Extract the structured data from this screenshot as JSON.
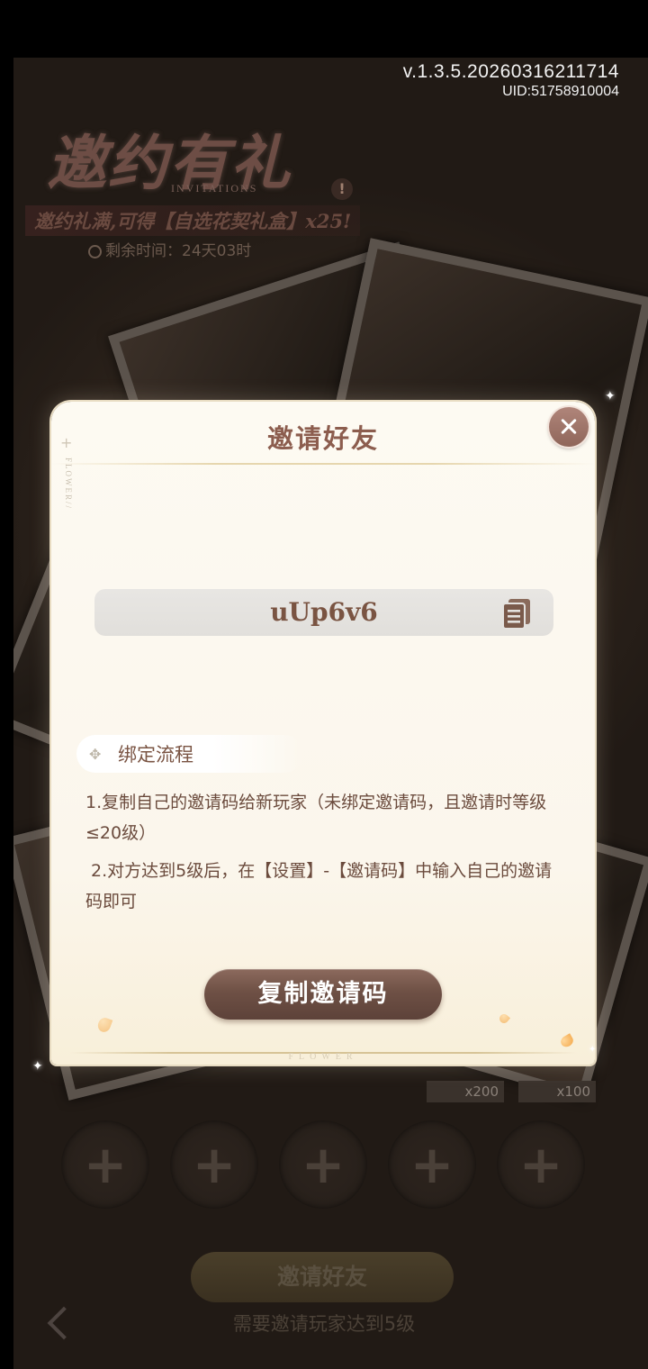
{
  "status_bar": {
    "version": "v.1.3.5.20260316211714",
    "uid": "UID:51758910004"
  },
  "event": {
    "title": "邀约有礼",
    "title_sub": "INVITATIONS",
    "banner": "邀约礼满,可得【自选花契礼盒】x25!",
    "timer": "剩余时间：24天03时"
  },
  "rewards": [
    {
      "count": "x200"
    },
    {
      "count": "x100"
    }
  ],
  "invite_slots": [
    {
      "label": "+"
    },
    {
      "label": "+"
    },
    {
      "label": "+"
    },
    {
      "label": "+"
    },
    {
      "label": "+"
    }
  ],
  "background_footer": {
    "invite_button_label": "邀请好友",
    "hint": "需要邀请玩家达到5级"
  },
  "modal": {
    "title": "邀请好友",
    "invite_code": "uUp6v6",
    "section_title": "绑定流程",
    "steps": [
      "1.复制自己的邀请码给新玩家（未绑定邀请码，且邀请时等级≤20级）",
      " 2.对方达到5级后，在【设置】-【邀请码】中输入自己的邀请码即可"
    ],
    "copy_button_label": "复制邀请码",
    "side_deco": "FLOWER//",
    "bottom_deco": "FLOWER"
  },
  "colors": {
    "modal_title": "#8c5d4e",
    "button_brown": "#6e5045",
    "text_brown": "#6b4b3d"
  }
}
